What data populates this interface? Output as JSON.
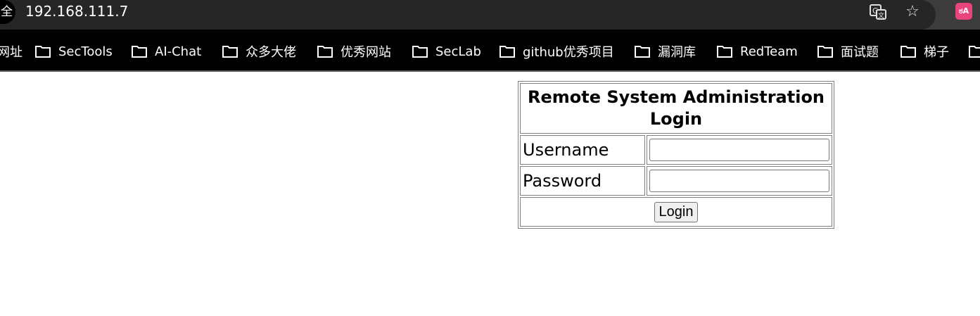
{
  "browser": {
    "site_chip": "全",
    "url": "192.168.111.7",
    "extension_label": "ಠA"
  },
  "bookmarks": {
    "first_partial": "网址",
    "items": [
      "SecTools",
      "AI-Chat",
      "众多大佬",
      "优秀网站",
      "SecLab",
      "github优秀项目",
      "漏洞库",
      "RedTeam",
      "面试题",
      "梯子"
    ]
  },
  "login": {
    "title_line1": "Remote System Administration",
    "title_line2": "Login",
    "username_label": "Username",
    "username_value": "",
    "password_label": "Password",
    "password_value": "",
    "login_button": "Login"
  }
}
